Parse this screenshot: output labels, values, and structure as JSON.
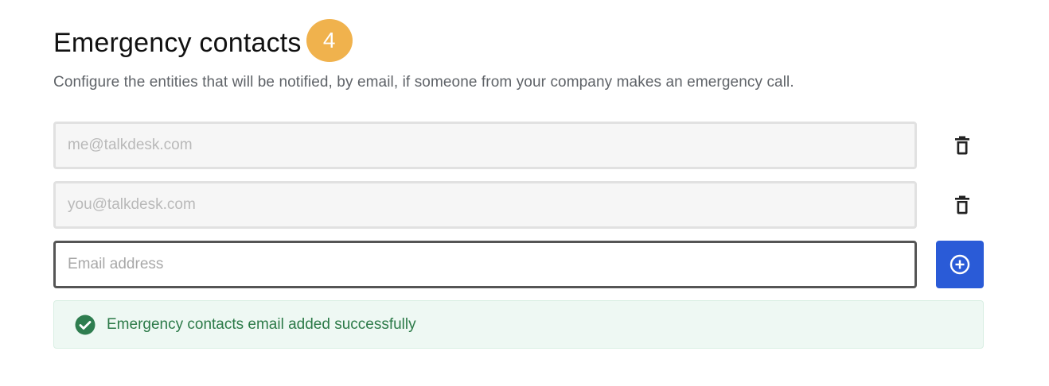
{
  "section": {
    "title": "Emergency contacts",
    "badge": "4",
    "description": "Configure the entities that will be notified, by email, if someone from your company makes an emergency call."
  },
  "contacts": [
    {
      "value": "me@talkdesk.com",
      "action_icon": "trash-icon"
    },
    {
      "value": "you@talkdesk.com",
      "action_icon": "trash-icon"
    }
  ],
  "new_contact": {
    "value": "",
    "placeholder": "Email address",
    "action_icon": "plus-circle-icon"
  },
  "alert": {
    "text": "Emergency contacts email added successfully",
    "icon": "check-circle-icon",
    "color": "#2c7a48"
  },
  "colors": {
    "badge": "#f0b24d",
    "primary_button": "#2a5bd7",
    "alert_background": "#eef8f3"
  }
}
